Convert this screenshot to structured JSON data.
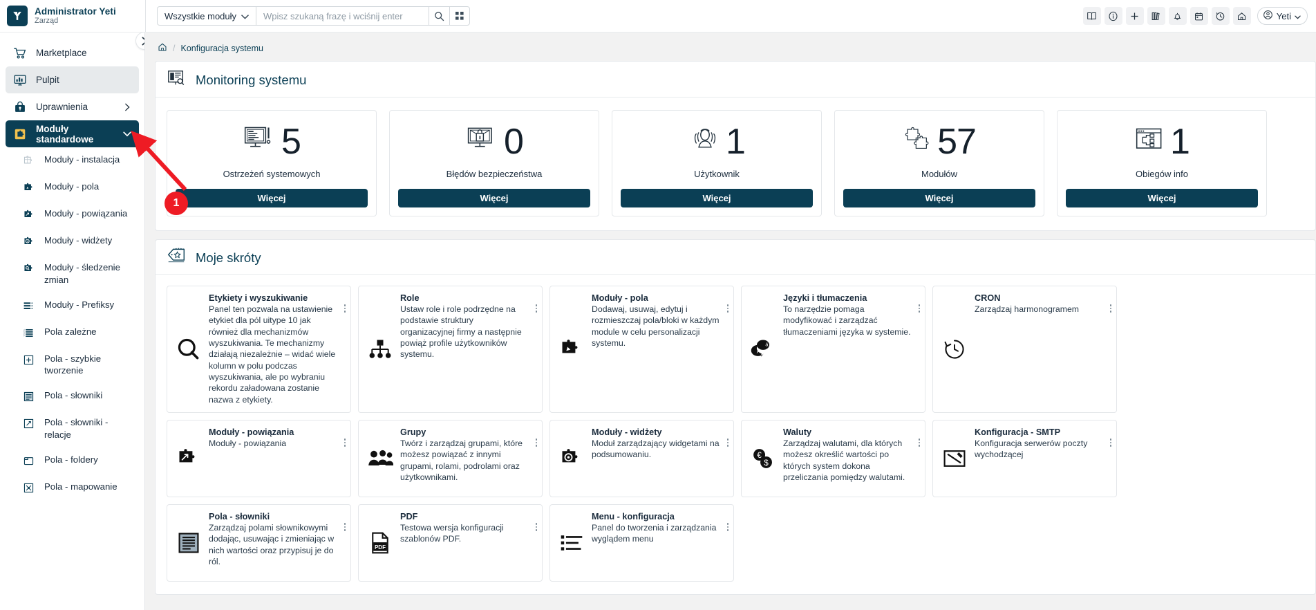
{
  "brand": {
    "name": "Administrator Yeti",
    "role": "Zarząd",
    "logo_icon": "yeti-logo-icon",
    "accent": "#0b3f55"
  },
  "topbar": {
    "module_filter_label": "Wszystkie moduły",
    "module_filter_icon": "chevron-down-icon",
    "search_placeholder": "Wpisz szukaną frazę i wciśnij enter",
    "search_value": "",
    "search_icon": "search-icon",
    "grid_icon": "grid-icon",
    "right_icons": [
      {
        "name": "book-icon"
      },
      {
        "name": "info-circle-icon"
      },
      {
        "name": "plus-icon"
      },
      {
        "name": "library-icon"
      },
      {
        "name": "bell-icon"
      },
      {
        "name": "calendar-icon"
      },
      {
        "name": "history-icon"
      },
      {
        "name": "home-icon"
      }
    ],
    "user_chip": {
      "label": "Yeti",
      "avatar_icon": "user-circle-icon",
      "chevron_icon": "chevron-down-icon"
    }
  },
  "sidebar": {
    "collapse_icon": "chevron-right-icon",
    "items": [
      {
        "label": "Marketplace",
        "icon": "shopping-cart-icon",
        "state": "normal",
        "chevron": ""
      },
      {
        "label": "Pulpit",
        "icon": "dashboard-chart-icon",
        "state": "active",
        "chevron": ""
      },
      {
        "label": "Uprawnienia",
        "icon": "lock-bag-icon",
        "state": "normal",
        "chevron": "chevron-right-icon"
      },
      {
        "label": "Moduły standardowe",
        "icon": "puzzle-yellow-icon",
        "state": "selected",
        "chevron": "chevron-down-icon"
      }
    ],
    "subitems": [
      {
        "label": "Moduły - instalacja",
        "icon": "puzzle-grid-icon"
      },
      {
        "label": "Moduły - pola",
        "icon": "puzzle-pencil-icon"
      },
      {
        "label": "Moduły - powiązania",
        "icon": "puzzle-arrows-icon"
      },
      {
        "label": "Moduły - widżety",
        "icon": "puzzle-widget-icon"
      },
      {
        "label": "Moduły - śledzenie zmian",
        "icon": "puzzle-search-icon"
      },
      {
        "label": "Moduły - Prefiksy",
        "icon": "list-prefix-icon"
      },
      {
        "label": "Pola zależne",
        "icon": "list-lines-icon"
      },
      {
        "label": "Pola - szybkie tworzenie",
        "icon": "plus-box-icon"
      },
      {
        "label": "Pola - słowniki",
        "icon": "document-lines-icon"
      },
      {
        "label": "Pola - słowniki - relacje",
        "icon": "arrows-box-icon"
      },
      {
        "label": "Pola - foldery",
        "icon": "folder-icon"
      },
      {
        "label": "Pola - mapowanie",
        "icon": "mapping-box-icon"
      }
    ]
  },
  "breadcrumb": {
    "home_icon": "home-icon",
    "separator": "/",
    "items": [
      "Konfiguracja systemu"
    ]
  },
  "monitoring": {
    "title": "Monitoring systemu",
    "icon": "monitoring-report-icon",
    "cards": [
      {
        "value": "5",
        "label": "Ostrzeżeń systemowych",
        "button": "Więcej",
        "icon": "monitor-warning-icon"
      },
      {
        "value": "0",
        "label": "Błędów bezpieczeństwa",
        "button": "Więcej",
        "icon": "monitor-lock-icon"
      },
      {
        "value": "1",
        "label": "Użytkownik",
        "button": "Więcej",
        "icon": "user-group-icon"
      },
      {
        "value": "57",
        "label": "Modułów",
        "button": "Więcej",
        "icon": "puzzle-pieces-icon"
      },
      {
        "value": "1",
        "label": "Obiegów info",
        "button": "Więcej",
        "icon": "workflow-window-icon"
      }
    ]
  },
  "shortcuts": {
    "title": "Moje skróty",
    "icon": "tag-star-icon",
    "menu_icon": "vertical-dots-icon",
    "items": [
      {
        "title": "Etykiety i wyszukiwanie",
        "desc": "Panel ten pozwala na ustawienie etykiet dla pól uitype 10 jak również dla mechanizmów wyszukiwania. Te mechanizmy działają niezależnie – widać wiele kolumn w polu podczas wyszukiwania, ale po wybraniu rekordu załadowana zostanie nazwa z etykiety.",
        "icon": "magnifier-icon",
        "tall": true
      },
      {
        "title": "Role",
        "desc": "Ustaw role i role podrzędne na podstawie struktury organizacyjnej firmy a następnie powiąż profile użytkowników systemu.",
        "icon": "org-chart-icon",
        "tall": true
      },
      {
        "title": "Moduły - pola",
        "desc": "Dodawaj, usuwaj, edytuj i rozmieszczaj pola/bloki w każdym module w celu personalizacji systemu.",
        "icon": "puzzle-pencil-icon",
        "tall": true
      },
      {
        "title": "Języki i tłumaczenia",
        "desc": "To narzędzie pomaga modyfikować i zarządzać tłumaczeniami języka w systemie.",
        "icon": "translate-bubble-icon",
        "tall": true
      },
      {
        "title": "CRON",
        "desc": "Zarządzaj harmonogramem",
        "icon": "clock-arrow-icon",
        "tall": true
      },
      {
        "title": "Moduły - powiązania",
        "desc": "Moduły - powiązania",
        "icon": "puzzle-arrows-icon",
        "tall": false
      },
      {
        "title": "Grupy",
        "desc": "Twórz i zarządzaj grupami, które możesz powiązać z innymi grupami, rolami, podrolami oraz użytkownikami.",
        "icon": "people-group-icon",
        "tall": false
      },
      {
        "title": "Moduły - widżety",
        "desc": "Moduł zarządzający widgetami na podsumowaniu.",
        "icon": "puzzle-widget-icon",
        "tall": false
      },
      {
        "title": "Waluty",
        "desc": "Zarządzaj walutami, dla których możesz określić wartości po których system dokona przeliczania pomiędzy walutami.",
        "icon": "currency-icon",
        "tall": false
      },
      {
        "title": "Konfiguracja - SMTP",
        "desc": "Konfiguracja serwerów poczty wychodzącej",
        "icon": "envelope-pen-icon",
        "tall": false
      },
      {
        "title": "Pola - słowniki",
        "desc": "Zarządzaj polami słownikowymi dodając, usuwając i zmieniając w nich wartości oraz przypisuj je do ról.",
        "icon": "document-lines-icon",
        "tall": false
      },
      {
        "title": "PDF",
        "desc": "Testowa wersja konfiguracji szablonów PDF.",
        "icon": "pdf-icon",
        "tall": false
      },
      {
        "title": "Menu - konfiguracja",
        "desc": "Panel do tworzenia i zarządzania wyglądem menu",
        "icon": "menu-list-icon",
        "tall": false
      }
    ]
  },
  "annotation": {
    "badge_label": "1",
    "badge_color": "#ee1b24",
    "target": "Moduły standardowe"
  }
}
